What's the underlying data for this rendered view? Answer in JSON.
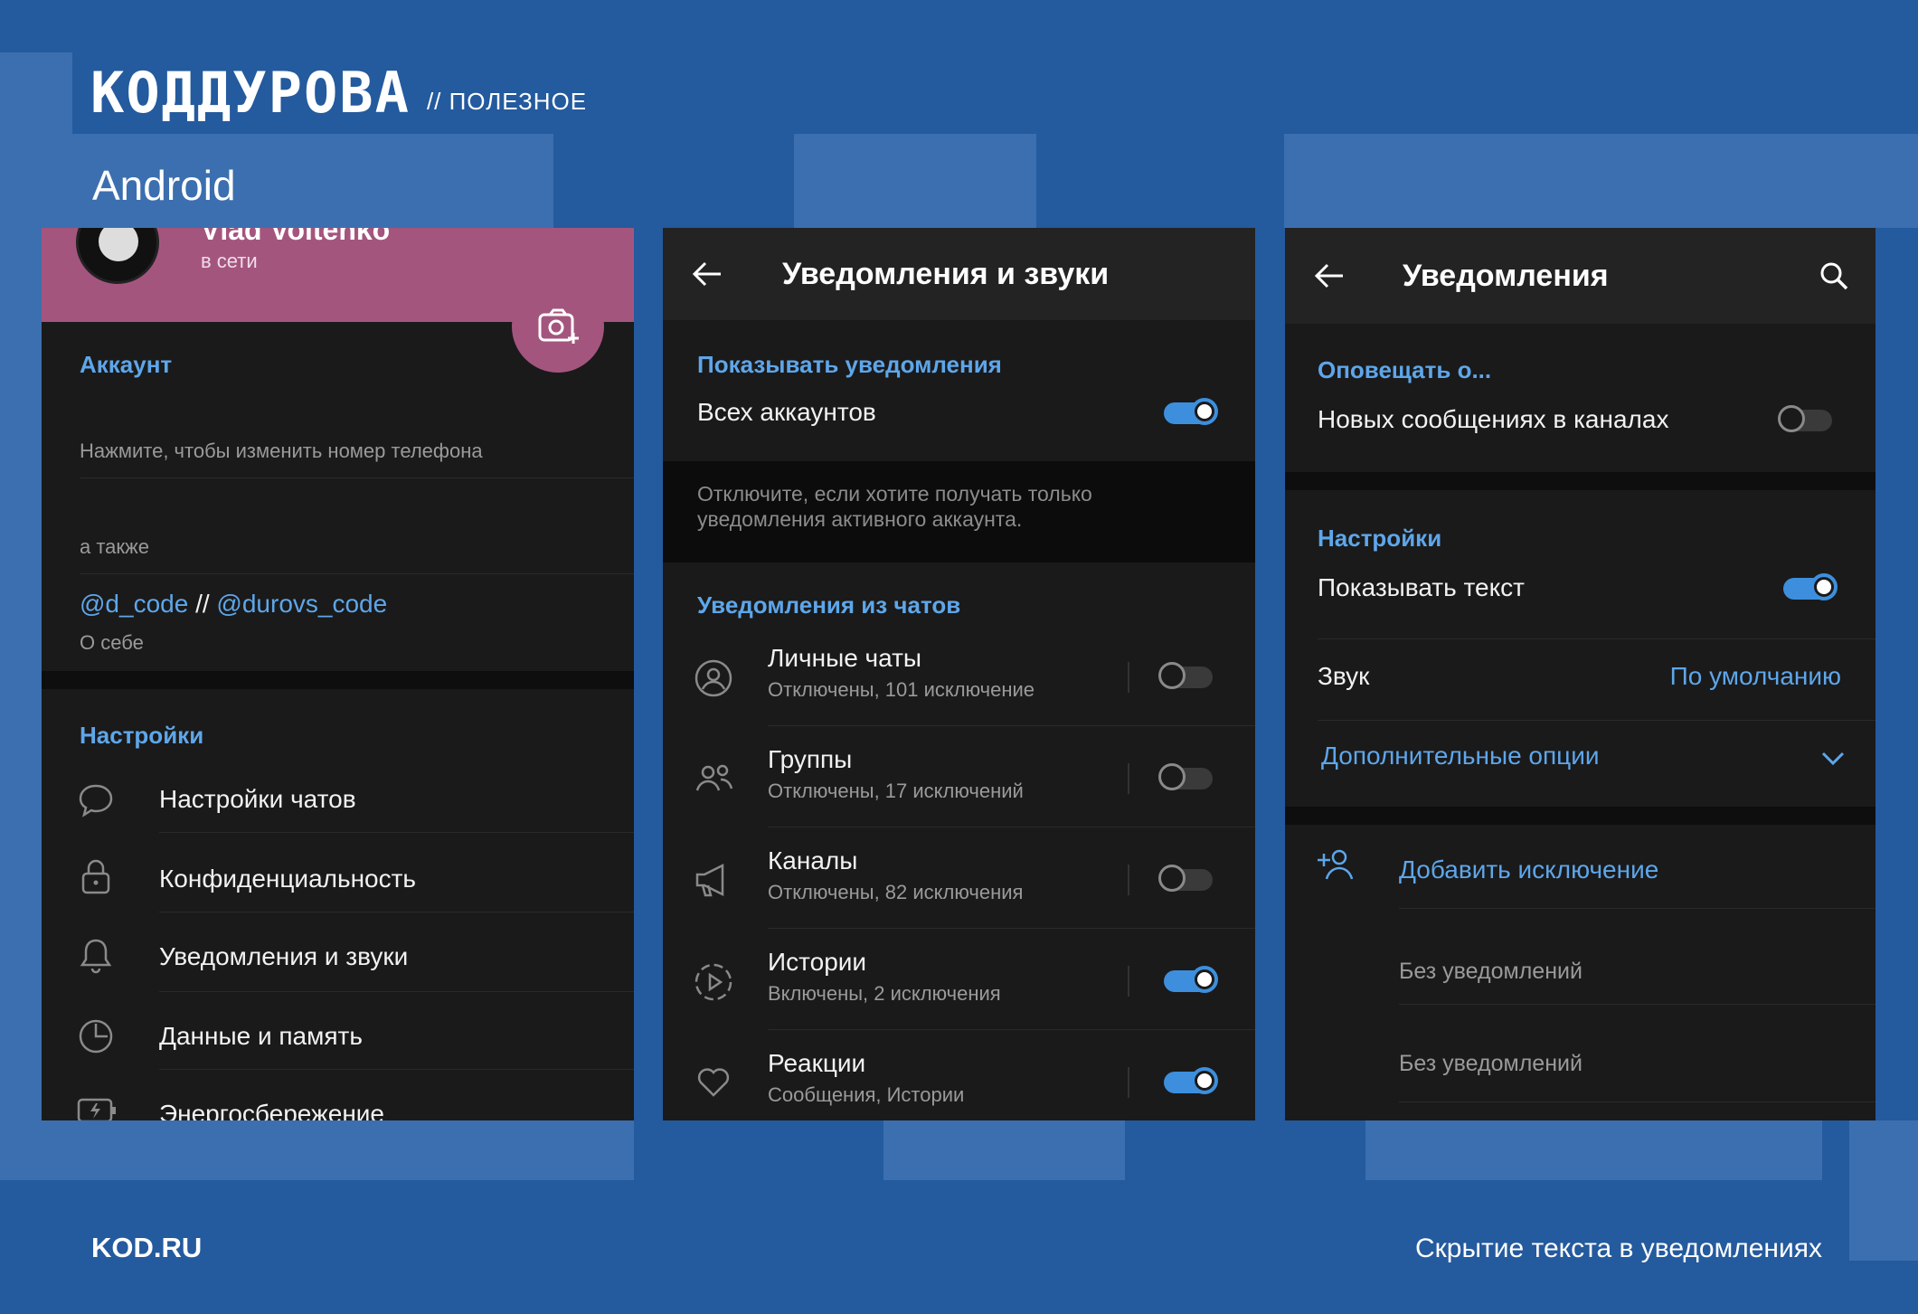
{
  "brand": {
    "logo": "КОДДУРОВА",
    "tag": "// ПОЛЕЗНОЕ"
  },
  "platform": "Android",
  "footer": {
    "left": "KOD.RU",
    "right": "Скрытие текста в уведомлениях"
  },
  "colors": {
    "background": "#245A9E",
    "accent": "#5EA6EA",
    "panel": "#1A1A1A",
    "profile_banner": "#A4557E"
  },
  "screen1": {
    "profile": {
      "name": "Vlad Voitenko",
      "status": "в сети"
    },
    "account_section": "Аккаунт",
    "phone_hint": "Нажмите, чтобы изменить номер телефона",
    "also_label": "а также",
    "bio_handle1": "@d_code",
    "bio_sep": " // ",
    "bio_handle2": "@durovs_code",
    "bio_label": "О себе",
    "settings_section": "Настройки",
    "menu": [
      {
        "icon": "chat-bubble-icon",
        "label": "Настройки чатов"
      },
      {
        "icon": "lock-icon",
        "label": "Конфиденциальность"
      },
      {
        "icon": "bell-icon",
        "label": "Уведомления и звуки"
      },
      {
        "icon": "pie-chart-icon",
        "label": "Данные и память"
      },
      {
        "icon": "battery-icon",
        "label": "Энергосбережение"
      }
    ]
  },
  "screen2": {
    "title": "Уведомления и звуки",
    "show_section": "Показывать уведомления",
    "all_accounts": "Всех аккаунтов",
    "all_accounts_on": true,
    "hint": "Отключите, если хотите получать только уведомления активного аккаунта.",
    "chats_section": "Уведомления из чатов",
    "items": [
      {
        "icon": "person-icon",
        "label": "Личные чаты",
        "sub": "Отключены, 101 исключение",
        "on": false
      },
      {
        "icon": "group-icon",
        "label": "Группы",
        "sub": "Отключены, 17 исключений",
        "on": false
      },
      {
        "icon": "megaphone-icon",
        "label": "Каналы",
        "sub": "Отключены, 82 исключения",
        "on": false
      },
      {
        "icon": "stories-icon",
        "label": "Истории",
        "sub": "Включены, 2 исключения",
        "on": true
      },
      {
        "icon": "heart-icon",
        "label": "Реакции",
        "sub": "Сообщения, Истории",
        "on": true
      }
    ]
  },
  "screen3": {
    "title": "Уведомления",
    "notify_section": "Оповещать о...",
    "new_channel_msgs": "Новых сообщениях в каналах",
    "new_channel_msgs_on": false,
    "settings_section": "Настройки",
    "show_text": "Показывать текст",
    "show_text_on": true,
    "sound_label": "Звук",
    "sound_value": "По умолчанию",
    "more_options": "Дополнительные опции",
    "add_exception": "Добавить исключение",
    "exceptions": [
      "Без уведомлений",
      "Без уведомлений"
    ]
  }
}
